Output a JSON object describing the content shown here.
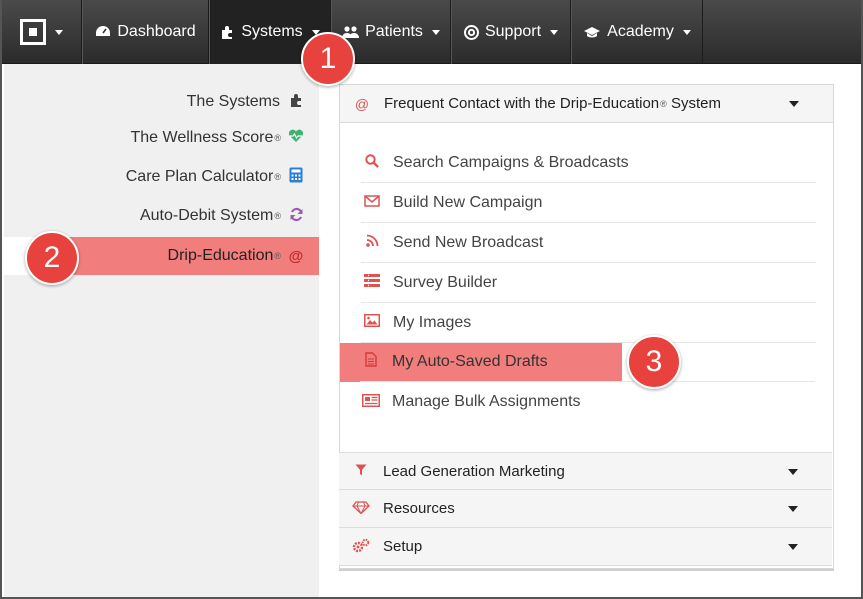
{
  "topnav": {
    "items": [
      {
        "label": "Dashboard",
        "icon": "dashboard-icon"
      },
      {
        "label": "Systems",
        "icon": "puzzle-icon"
      },
      {
        "label": "Patients",
        "icon": "users-icon"
      },
      {
        "label": "Support",
        "icon": "lifebuoy-icon"
      },
      {
        "label": "Academy",
        "icon": "graduation-cap-icon"
      }
    ]
  },
  "sidebar": {
    "items": [
      {
        "label": "The Systems",
        "reg": "",
        "icon": "puzzle-icon",
        "color": "#444444"
      },
      {
        "label": "The Wellness Score",
        "reg": "®",
        "icon": "heartbeat-icon",
        "color": "#3cb371"
      },
      {
        "label": "Care Plan Calculator",
        "reg": "®",
        "icon": "calculator-icon",
        "color": "#2a7fd4"
      },
      {
        "label": "Auto-Debit System",
        "reg": "®",
        "icon": "refresh-icon",
        "color": "#9b59b6"
      },
      {
        "label": "Drip-Education",
        "reg": "®",
        "icon": "at-icon",
        "color": "#e05252"
      }
    ]
  },
  "panel": {
    "header": {
      "label": "Frequent Contact with the Drip-Education",
      "reg": "®",
      "suffix": " System"
    },
    "menu": [
      {
        "label": "Search Campaigns & Broadcasts",
        "icon": "search-icon"
      },
      {
        "label": "Build New Campaign",
        "icon": "envelope-icon"
      },
      {
        "label": "Send New Broadcast",
        "icon": "rss-icon"
      },
      {
        "label": "Survey Builder",
        "icon": "list-icon"
      },
      {
        "label": "My Images",
        "icon": "image-icon"
      },
      {
        "label": "My Auto-Saved Drafts",
        "icon": "file-icon"
      },
      {
        "label": "Manage Bulk Assignments",
        "icon": "newspaper-icon"
      }
    ],
    "sections": [
      {
        "label": "Lead Generation Marketing",
        "icon": "funnel-icon"
      },
      {
        "label": "Resources",
        "icon": "diamond-icon"
      },
      {
        "label": "Setup",
        "icon": "gears-icon"
      }
    ]
  },
  "badges": [
    "1",
    "2",
    "3"
  ],
  "colors": {
    "accent": "#e8423e",
    "highlight": "#f27d7d",
    "navbar": "#333333"
  }
}
